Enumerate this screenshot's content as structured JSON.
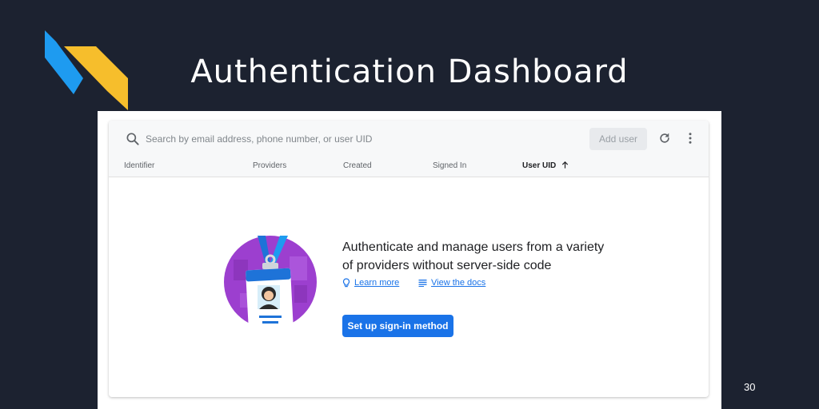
{
  "slide": {
    "title": "Authentication Dashboard",
    "page_number": "30"
  },
  "colors": {
    "background": "#1c2230",
    "logo_blue": "#1e9bf0",
    "logo_yellow": "#f6be2c",
    "primary": "#1a73e8"
  },
  "toolbar": {
    "search_icon": "search-icon",
    "search_placeholder": "Search by email address, phone number, or user UID",
    "add_user_label": "Add user",
    "refresh_icon": "refresh-icon",
    "more_icon": "more-vert-icon"
  },
  "table": {
    "columns": [
      "Identifier",
      "Providers",
      "Created",
      "Signed In",
      "User UID"
    ],
    "sorted_column": "User UID",
    "sort_direction": "ascending"
  },
  "empty_state": {
    "title": "Authenticate and manage users from a variety of providers without server-side code",
    "learn_more_label": "Learn more",
    "view_docs_label": "View the docs",
    "setup_label": "Set up sign-in method"
  }
}
